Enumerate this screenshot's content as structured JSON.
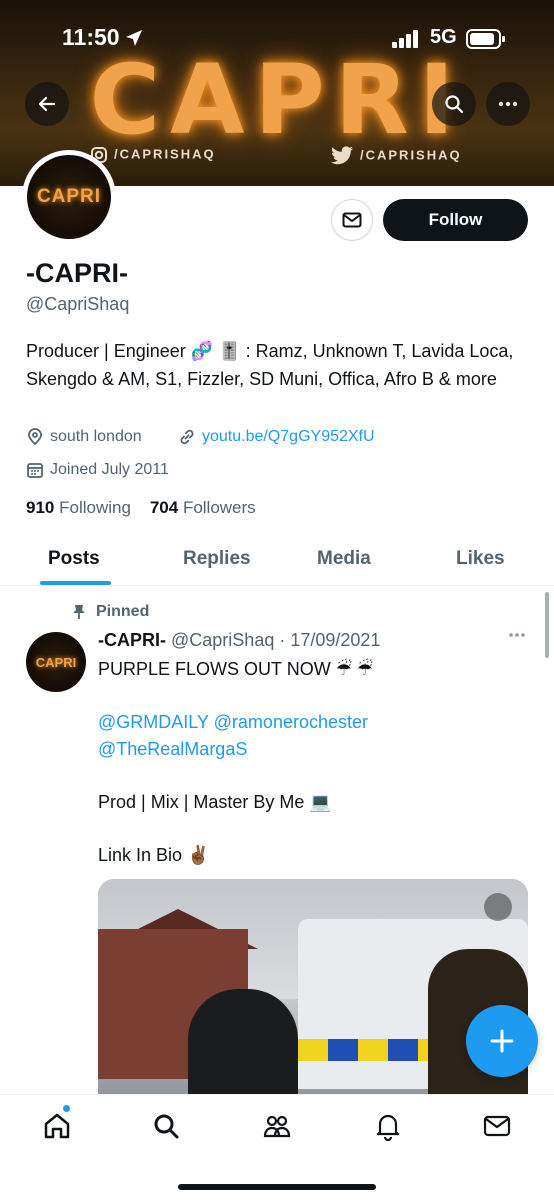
{
  "status_bar": {
    "time": "11:50",
    "network": "5G"
  },
  "banner": {
    "title": "CAPRI",
    "instagram_handle": "/CAPRISHAQ",
    "twitter_handle": "/CAPRISHAQ"
  },
  "profile": {
    "avatar_text": "CAPRI",
    "follow_label": "Follow",
    "name": "-CAPRI-",
    "handle": "@CapriShaq",
    "bio": "Producer | Engineer 🧬 🎚️ : Ramz, Unknown T, Lavida Loca, Skengdo & AM, S1, Fizzler, SD Muni, Offica, Afro B & more",
    "location": "south london",
    "link": "youtu.be/Q7gGY952XfU",
    "joined": "Joined July 2011",
    "following_count": "910",
    "following_label": "Following",
    "followers_count": "704",
    "followers_label": "Followers"
  },
  "tabs": [
    {
      "label": "Posts",
      "active": true
    },
    {
      "label": "Replies"
    },
    {
      "label": "Media"
    },
    {
      "label": "Likes"
    }
  ],
  "tweet": {
    "pinned_label": "Pinned",
    "avatar_text": "CAPRI",
    "author_name": "-CAPRI-",
    "author_handle": "@CapriShaq",
    "date": "· 17/09/2021",
    "line1": "PURPLE FLOWS OUT NOW ☔ ☔",
    "mention1": "@GRMDAILY",
    "mention2": "@ramonerochester",
    "mention3": "@TheRealMargaS",
    "line3": "Prod | Mix | Master By Me 💻",
    "line4": "Link In Bio ✌🏾"
  },
  "colors": {
    "accent": "#1d9bf0",
    "text": "#0f1419",
    "secondary": "#536471"
  }
}
